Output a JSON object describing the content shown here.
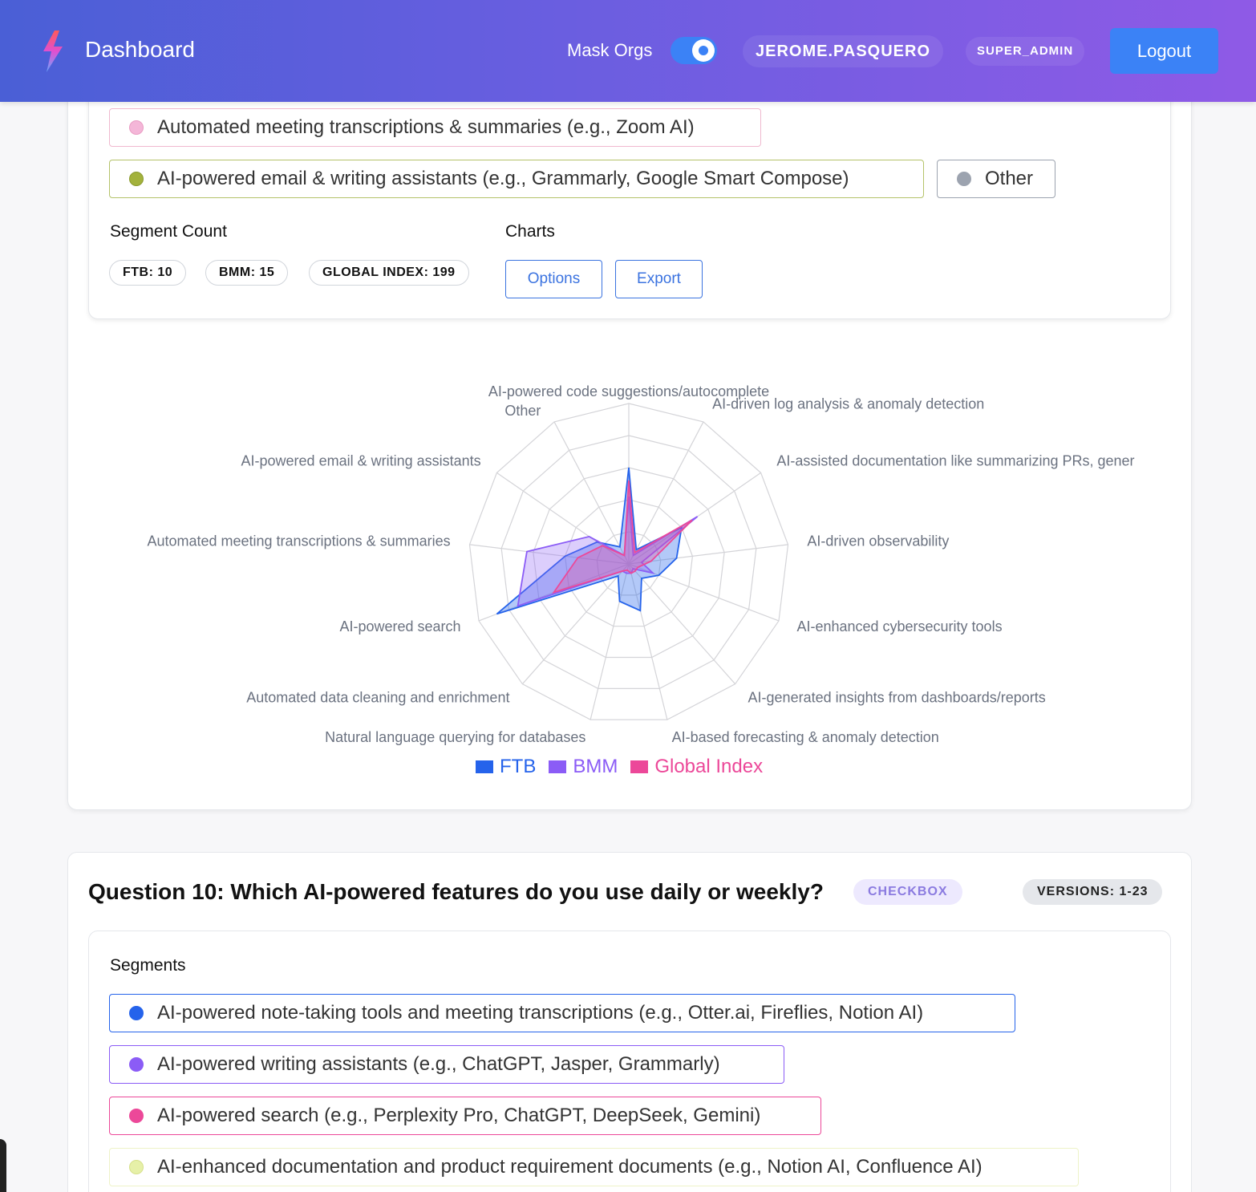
{
  "header": {
    "brand": "Dashboard",
    "mask_label": "Mask Orgs",
    "mask_enabled": true,
    "username": "JEROME.PASQUERO",
    "role": "SUPER_ADMIN",
    "logout_label": "Logout",
    "accent": "#3b82f6"
  },
  "segments_top": [
    {
      "label": "Automated meeting transcriptions & summaries (e.g., Zoom AI)",
      "color": "#f4b6d8",
      "border": "#f0b9cf"
    },
    {
      "label": "AI-powered email & writing assistants (e.g., Grammarly, Google Smart Compose)",
      "color": "#a3b23c",
      "border": "#b5c36a"
    },
    {
      "label": "Other",
      "color": "#9ca3af",
      "border": "#9ca3af"
    }
  ],
  "segment_count": {
    "label": "Segment Count",
    "pills": [
      "FTB: 10",
      "BMM: 15",
      "GLOBAL INDEX: 199"
    ]
  },
  "charts": {
    "label": "Charts",
    "options_label": "Options",
    "export_label": "Export"
  },
  "chart_data": {
    "type": "radar",
    "axes": [
      "AI-powered code suggestions/autocomplete",
      "AI-driven log analysis & anomaly detection",
      "AI-assisted documentation like summarizing PRs, generating",
      "AI-driven observability",
      "AI-enhanced cybersecurity tools",
      "AI-generated insights from dashboards/reports",
      "AI-based forecasting & anomaly detection",
      "Natural language querying for databases",
      "Automated data cleaning and enrichment",
      "AI-powered search",
      "Automated meeting transcriptions & summaries",
      "AI-powered email & writing assistants",
      "Other"
    ],
    "axis_labels_display": [
      "AI-powered code suggestions/autocomplete",
      "AI-driven log analysis & anomaly detection",
      "AI-assisted documentation like summarizing PRs, gener",
      "AI-driven observability",
      "AI-enhanced cybersecurity tools",
      "AI-generated insights from dashboards/reports",
      "AI-based forecasting & anomaly detection",
      "Natural language querying for databases",
      "Automated data cleaning and enrichment",
      "AI-powered search",
      "Automated meeting transcriptions & summaries",
      "AI-powered email & writing assistants",
      "Other"
    ],
    "rings": 5,
    "max": 5,
    "series": [
      {
        "name": "FTB",
        "color": "#2563eb",
        "fill": "rgba(37,99,235,0.35)",
        "values": [
          3.0,
          0.5,
          2.0,
          1.5,
          1.0,
          0.6,
          1.5,
          1.2,
          0.5,
          4.4,
          2.0,
          1.2,
          0.6
        ]
      },
      {
        "name": "BMM",
        "color": "#8b5cf6",
        "fill": "rgba(139,92,246,0.30)",
        "values": [
          2.1,
          0.3,
          2.6,
          0.4,
          0.8,
          0.2,
          0.3,
          0.3,
          0.3,
          3.7,
          3.2,
          1.5,
          0.3
        ]
      },
      {
        "name": "Global Index",
        "color": "#ec4899",
        "fill": "rgba(236,72,153,0.30)",
        "values": [
          2.6,
          0.4,
          2.4,
          0.7,
          0.3,
          0.3,
          0.3,
          0.2,
          0.3,
          2.5,
          1.6,
          1.0,
          0.3
        ]
      }
    ]
  },
  "question": {
    "title": "Question 10: Which AI-powered features do you use daily or weekly?",
    "type": "CHECKBOX",
    "versions": "VERSIONS: 1-23",
    "segments_label": "Segments",
    "segments": [
      {
        "label": "AI-powered note-taking tools and meeting transcriptions (e.g., Otter.ai, Fireflies, Notion AI)",
        "color": "#2563eb",
        "border": "#2563eb"
      },
      {
        "label": "AI-powered writing assistants (e.g., ChatGPT, Jasper, Grammarly)",
        "color": "#8b5cf6",
        "border": "#8b5cf6"
      },
      {
        "label": "AI-powered search (e.g., Perplexity Pro, ChatGPT, DeepSeek, Gemini)",
        "color": "#ec4899",
        "border": "#ec4899"
      },
      {
        "label": "AI-enhanced documentation and product requirement documents (e.g., Notion AI, Confluence AI)",
        "color": "#e6f0a8",
        "border": "#eef3c8"
      }
    ]
  }
}
